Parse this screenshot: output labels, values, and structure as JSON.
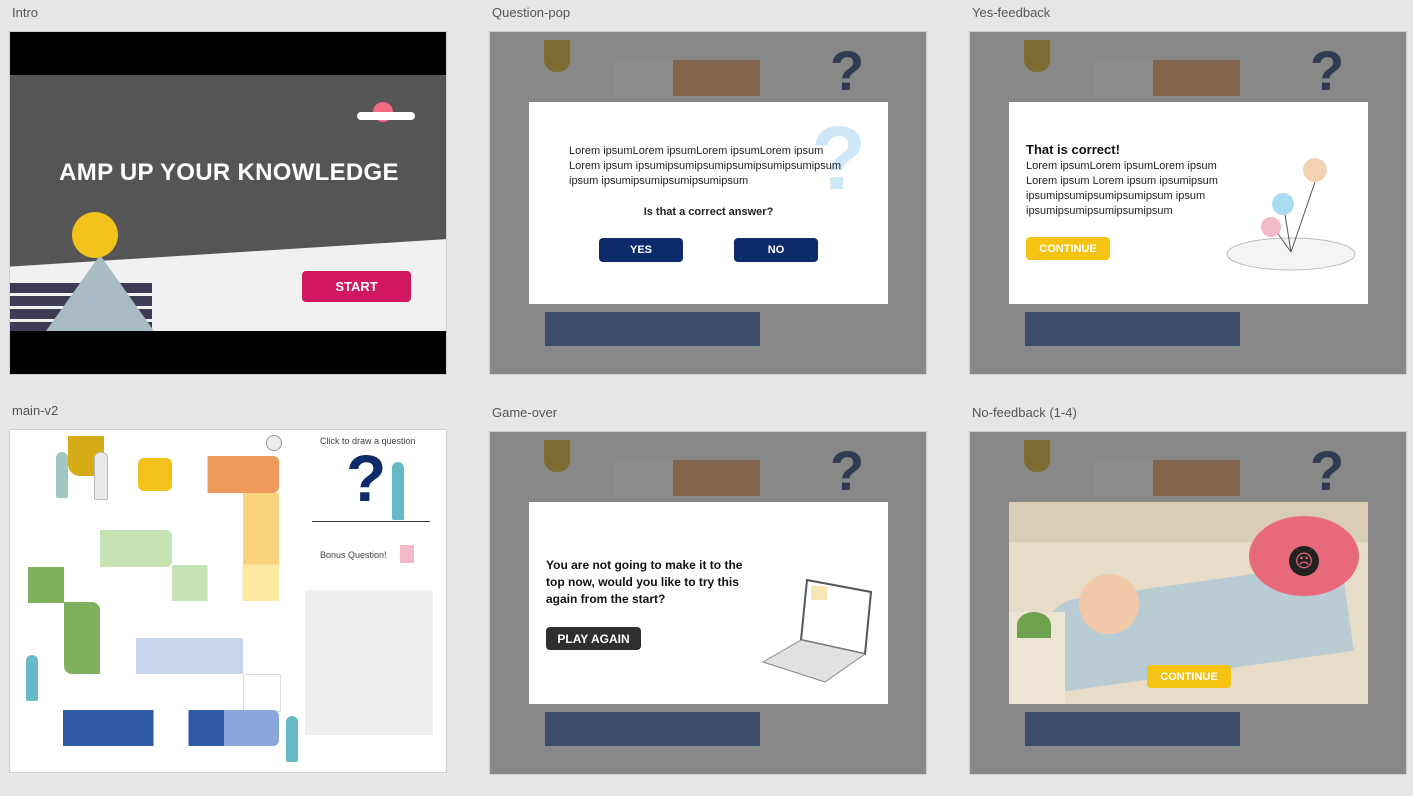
{
  "artboards": {
    "intro": {
      "label": "Intro",
      "title": "AMP UP YOUR KNOWLEDGE",
      "start_button": "START"
    },
    "question_pop": {
      "label": "Question-pop",
      "body_lines": [
        "Lorem ipsumLorem ipsumLorem ipsumLorem ipsum",
        "Lorem ipsum ipsumipsumipsumipsumipsumipsumipsum",
        "ipsum ipsumipsumipsumipsumipsum"
      ],
      "prompt": "Is that a correct answer?",
      "yes_button": "YES",
      "no_button": "NO"
    },
    "yes_feedback": {
      "label": "Yes-feedback",
      "heading": "That is correct!",
      "body_lines": [
        "Lorem ipsumLorem ipsumLorem ipsum",
        "Lorem ipsum Lorem ipsum ipsumipsum",
        "ipsumipsumipsumipsumipsum ipsum",
        "ipsumipsumipsumipsumipsum"
      ],
      "continue_button": "CONTINUE"
    },
    "main_v2": {
      "label": "main-v2",
      "draw_prompt": "Click to draw a question",
      "bonus_label": "Bonus Question!",
      "question_mark": "?"
    },
    "game_over": {
      "label": "Game-over",
      "message_lines": [
        "You are not going to make it to the",
        "top now, would you like to try this",
        "again from the start?"
      ],
      "play_again_button": "PLAY AGAIN"
    },
    "no_feedback": {
      "label": "No-feedback (1-4)",
      "continue_button": "CONTINUE"
    }
  },
  "icons": {
    "trophy": "trophy-icon",
    "question": "question-mark-icon",
    "gift": "gift-icon",
    "laptop": "laptop-icon",
    "sad_face": "sad-face-icon",
    "wheelchair": "wheelchair-icon",
    "stethoscope": "stethoscope-icon"
  },
  "colors": {
    "canvas": "#e6e6e6",
    "start": "#d1175f",
    "navy": "#0d2b6b",
    "yellow": "#f5c312",
    "dark": "#2f2f2f",
    "sun": "#f2c21b",
    "tile_orange": "#ef9a5a",
    "tile_yellow": "#fbd37f",
    "tile_green": "#7fb05e",
    "tile_blue": "#2d5aa3",
    "tile_lightblue": "#c9d6ee"
  }
}
